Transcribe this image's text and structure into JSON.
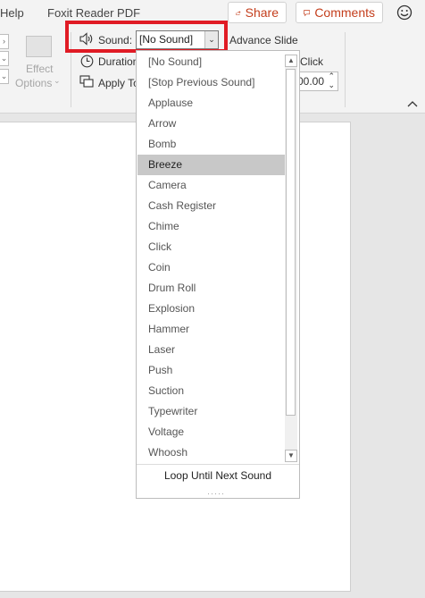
{
  "tabs": {
    "help": "Help",
    "foxit": "Foxit Reader PDF"
  },
  "actions": {
    "share": "Share",
    "comments": "Comments"
  },
  "ribbon": {
    "effect_options": [
      "Effect",
      "Options"
    ],
    "sound_label": "Sound:",
    "sound_value": "[No Sound]",
    "duration_label": "Duration",
    "apply_label": "Apply To",
    "advance_label": "Advance Slide",
    "on_click_label": "Click",
    "after_value": "00.00"
  },
  "dropdown": {
    "items": [
      "[No Sound]",
      "[Stop Previous Sound]",
      "Applause",
      "Arrow",
      "Bomb",
      "Breeze",
      "Camera",
      "Cash Register",
      "Chime",
      "Click",
      "Coin",
      "Drum Roll",
      "Explosion",
      "Hammer",
      "Laser",
      "Push",
      "Suction",
      "Typewriter",
      "Voltage",
      "Whoosh"
    ],
    "selected": "Breeze",
    "footer": "Loop Until Next Sound"
  },
  "colors": {
    "highlight": "#e01b24",
    "accent": "#c43e1c"
  },
  "icons": [
    "smiley-icon",
    "share-icon",
    "comment-icon",
    "speaker-icon",
    "clock-icon",
    "apply-icon",
    "chevron-down-icon",
    "chevron-up-icon"
  ]
}
